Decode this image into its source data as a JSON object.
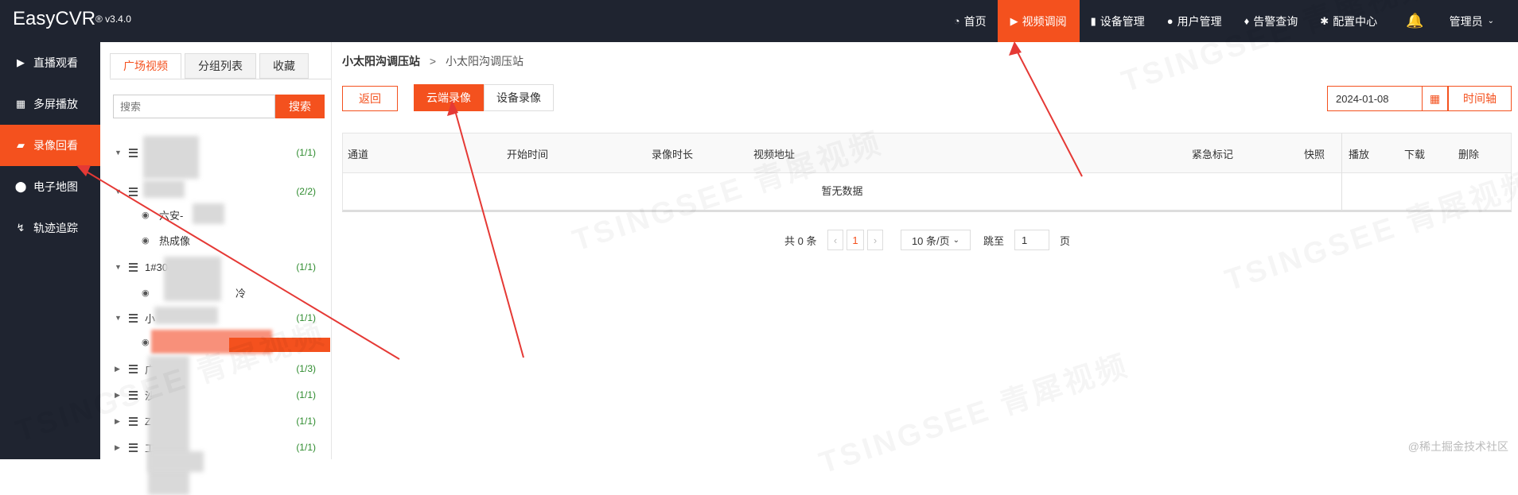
{
  "header": {
    "logo": "EasyCVR",
    "version": "® v3.4.0",
    "nav": [
      {
        "icon": "dashboard-icon",
        "label": "首页",
        "active": false
      },
      {
        "icon": "play-circle-icon",
        "label": "视频调阅",
        "active": true
      },
      {
        "icon": "device-icon",
        "label": "设备管理",
        "active": false
      },
      {
        "icon": "user-icon",
        "label": "用户管理",
        "active": false
      },
      {
        "icon": "alarm-icon",
        "label": "告警查询",
        "active": false
      },
      {
        "icon": "gear-icon",
        "label": "配置中心",
        "active": false
      }
    ],
    "user": "管理员"
  },
  "sidebar": {
    "items": [
      {
        "icon": "play-icon",
        "label": "直播观看",
        "active": false
      },
      {
        "icon": "grid-icon",
        "label": "多屏播放",
        "active": false
      },
      {
        "icon": "video-icon",
        "label": "录像回看",
        "active": true
      },
      {
        "icon": "map-pin-icon",
        "label": "电子地图",
        "active": false
      },
      {
        "icon": "track-icon",
        "label": "轨迹追踪",
        "active": false
      }
    ]
  },
  "tree_panel": {
    "tabs": [
      "广场视频",
      "分组列表",
      "收藏"
    ],
    "search_placeholder": "搜索",
    "search_button": "搜索",
    "nodes": [
      {
        "name": "",
        "count": "(1/1)"
      },
      {
        "name": "",
        "count": "(2/2)"
      },
      {
        "name": "六安-",
        "count": ""
      },
      {
        "name": "热成像",
        "count": ""
      },
      {
        "name": "1#304--3",
        "count": "(1/1)"
      },
      {
        "name": "冷",
        "count": ""
      },
      {
        "name": "小",
        "count": "(1/1)"
      },
      {
        "name": "",
        "count": ""
      },
      {
        "name": "广",
        "count": "(1/3)"
      },
      {
        "name": "沙",
        "count": "(1/1)"
      },
      {
        "name": "Z",
        "count": "(1/1)"
      },
      {
        "name": "工",
        "count": "(1/1)"
      }
    ]
  },
  "main": {
    "breadcrumb": [
      "小太阳沟调压站",
      "小太阳沟调压站"
    ],
    "back_button": "返回",
    "record_tabs": [
      "云端录像",
      "设备录像"
    ],
    "date": "2024-01-08",
    "time_axis_button": "时间轴",
    "columns": [
      "通道",
      "开始时间",
      "录像时长",
      "视频地址",
      "紧急标记",
      "快照",
      "播放",
      "下载",
      "删除"
    ],
    "empty_text": "暂无数据",
    "pagination": {
      "total": "共 0 条",
      "current_page": "1",
      "page_size": "10 条/页",
      "jump_label": "跳至",
      "jump_value": "1",
      "page_suffix": "页"
    }
  },
  "watermark": "TSINGSEE 青犀视频",
  "credit": "@稀土掘金技术社区",
  "colors": {
    "accent": "#f4511e",
    "dark": "#1f2430"
  }
}
